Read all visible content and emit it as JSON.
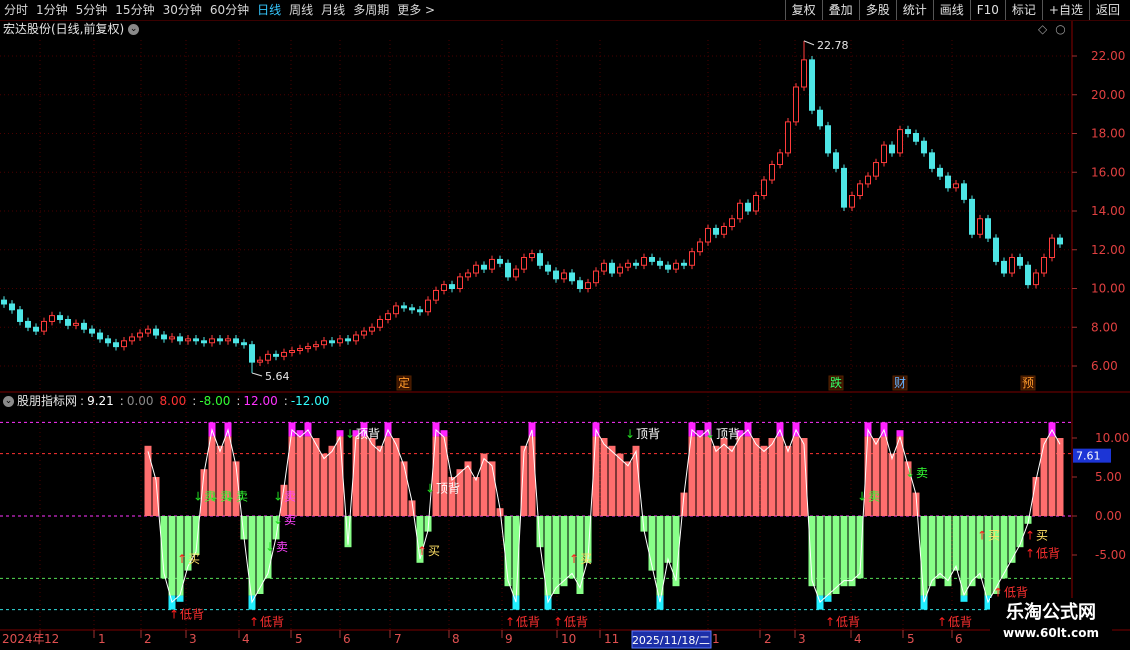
{
  "toolbar": {
    "left": [
      "分时",
      "1分钟",
      "5分钟",
      "15分钟",
      "30分钟",
      "60分钟",
      "日线",
      "周线",
      "月线",
      "多周期",
      "更多 >"
    ],
    "active_index": 6,
    "right": [
      "复权",
      "叠加",
      "多股",
      "统计",
      "画线",
      "F10",
      "标记",
      "+自选",
      "返回"
    ]
  },
  "title": {
    "stock": "宏达股份(日线,前复权)"
  },
  "icons": {
    "title_toggle": "chevron-circle-icon",
    "chart_settings": "diamond-icon",
    "chart_close": "circle-icon"
  },
  "colors": {
    "up": "#ff3b3b",
    "down": "#4ee6e6",
    "grid": "#4a0000",
    "axis_text": "#e04040",
    "cursor_bg": "#1c2fa8"
  },
  "price_axis": {
    "values": [
      22,
      20,
      18,
      16,
      14,
      12,
      10,
      8,
      6
    ],
    "labels": [
      "22.00",
      "20.00",
      "18.00",
      "16.00",
      "14.00",
      "12.00",
      "10.00",
      "8.00",
      "6.00"
    ]
  },
  "indicator_axis": {
    "values": [
      10,
      5,
      0,
      -5
    ],
    "labels": [
      "10.00",
      "5.00",
      "0.00",
      "-5.00"
    ],
    "current": 7.61,
    "current_label": "7.61"
  },
  "indicator_legend": {
    "name": "股朋指标网",
    "items": [
      {
        "prefix": ":",
        "text": "9.21",
        "color": "#ffffff"
      },
      {
        "prefix": ":",
        "text": "0.00",
        "color": "#8a8a8a"
      },
      {
        "prefix": "",
        "text": "8.00",
        "color": "#ff3333"
      },
      {
        "prefix": ":",
        "text": "-8.00",
        "color": "#33ff33"
      },
      {
        "prefix": ":",
        "text": "12.00",
        "color": "#ff33ff"
      },
      {
        "prefix": ":",
        "text": "-12.00",
        "color": "#33ffff"
      }
    ]
  },
  "time_axis": {
    "labels": [
      "2024年",
      "12",
      "1",
      "2",
      "3",
      "4",
      "5",
      "6",
      "7",
      "8",
      "9",
      "10",
      "11",
      "1",
      "2",
      "3",
      "4",
      "5",
      "6"
    ],
    "cursor": "2025/11/18/二"
  },
  "watermark": {
    "title": "乐淘公式网",
    "url": "www.60lt.com"
  },
  "chart_data": {
    "type": "candlestick",
    "price": {
      "first_open": 9.4,
      "close": [
        9.2,
        8.9,
        8.3,
        8.0,
        7.8,
        8.3,
        8.6,
        8.4,
        8.1,
        8.2,
        7.9,
        7.7,
        7.4,
        7.2,
        7.0,
        7.3,
        7.5,
        7.7,
        7.9,
        7.6,
        7.4,
        7.5,
        7.3,
        7.4,
        7.3,
        7.2,
        7.4,
        7.3,
        7.4,
        7.2,
        7.1,
        6.2,
        6.3,
        6.6,
        6.5,
        6.7,
        6.8,
        6.9,
        7.0,
        7.1,
        7.3,
        7.2,
        7.4,
        7.3,
        7.6,
        7.8,
        8.0,
        8.4,
        8.7,
        9.1,
        9.0,
        8.9,
        8.8,
        9.4,
        9.9,
        10.2,
        10.0,
        10.6,
        10.8,
        11.2,
        11.0,
        11.5,
        11.3,
        10.6,
        11.0,
        11.6,
        11.8,
        11.2,
        10.9,
        10.5,
        10.8,
        10.4,
        10.0,
        10.3,
        10.9,
        11.3,
        10.8,
        11.1,
        11.3,
        11.2,
        11.6,
        11.4,
        11.2,
        11.0,
        11.3,
        11.2,
        11.9,
        12.4,
        13.1,
        12.8,
        13.2,
        13.6,
        14.4,
        14.0,
        14.8,
        15.6,
        16.4,
        17.0,
        18.6,
        20.4,
        21.8,
        19.2,
        18.4,
        17.0,
        16.2,
        14.2,
        14.8,
        15.4,
        15.8,
        16.5,
        17.4,
        17.0,
        18.2,
        18.0,
        17.6,
        17.0,
        16.2,
        15.8,
        15.2,
        15.4,
        14.6,
        12.8,
        13.6,
        12.6,
        11.4,
        10.8,
        11.6,
        11.2,
        10.2,
        10.8,
        11.6,
        12.6,
        12.3
      ],
      "max": 22.78,
      "max_label": "22.78",
      "min": 5.64,
      "min_label": "5.64",
      "events": [
        {
          "label": "定",
          "i": 50,
          "color": "#ff9a2a"
        },
        {
          "label": "跌",
          "i": 104,
          "color": "#33ff66"
        },
        {
          "label": "财",
          "i": 112,
          "color": "#66b3ff"
        },
        {
          "label": "预",
          "i": 128,
          "color": "#ff9a2a"
        }
      ]
    },
    "indicator": {
      "levels": [
        {
          "value": 12,
          "color": "#ff33ff"
        },
        {
          "value": 8,
          "color": "#ff3333"
        },
        {
          "value": 0,
          "color": "#ff33ff"
        },
        {
          "value": -8,
          "color": "#55dd55"
        },
        {
          "value": -12,
          "color": "#33dddd"
        }
      ],
      "values": [
        0,
        0,
        0,
        0,
        0,
        0,
        0,
        0,
        0,
        0,
        0,
        0,
        0,
        0,
        0,
        0,
        0,
        0,
        9,
        5,
        -8,
        -12,
        -11,
        -7,
        -5,
        6,
        12,
        9,
        12,
        7,
        -3,
        -12,
        -10,
        -8,
        -3,
        4,
        12,
        11,
        12,
        10,
        8,
        9,
        11,
        -4,
        11,
        12,
        10,
        9,
        12,
        10,
        7,
        2,
        -6,
        -2,
        12,
        11,
        5,
        6,
        7,
        5,
        8,
        7,
        1,
        -9,
        -12,
        9,
        12,
        -4,
        -12,
        -10,
        -9,
        -8,
        -10,
        -6,
        12,
        10,
        9,
        8,
        7,
        9,
        -2,
        -7,
        -12,
        -6,
        -9,
        3,
        12,
        11,
        12,
        9,
        10,
        9,
        11,
        12,
        10,
        9,
        10,
        12,
        9,
        12,
        10,
        -9,
        -12,
        -11,
        -10,
        -9,
        -9,
        -8,
        12,
        10,
        12,
        8,
        11,
        7,
        3,
        -12,
        -9,
        -8,
        -9,
        -7,
        -11,
        -9,
        -8,
        -12,
        -10,
        -8,
        -6,
        -4,
        -1,
        5,
        10,
        12,
        10
      ],
      "bar_colors": {
        "positive": "#ff6e6e",
        "top": "#ff22ff",
        "negative": "#88ff88",
        "bottom": "#22eeff",
        "line": "#ffffff"
      },
      "signals": [
        {
          "text": "卖",
          "i": 25,
          "v": 2.5,
          "color": "#33ff33",
          "arrow": "down"
        },
        {
          "text": "卖",
          "i": 27,
          "v": 2.5,
          "color": "#33ff33",
          "arrow": "down"
        },
        {
          "text": "卖",
          "i": 29,
          "v": 2.5,
          "color": "#33ff33",
          "arrow": "down"
        },
        {
          "text": "买",
          "i": 23,
          "v": -5.5,
          "color": "#ffe066",
          "arrow": "up"
        },
        {
          "text": "低背",
          "i": 22,
          "v": -12.6,
          "color": "#ff3030",
          "arrow": "up"
        },
        {
          "text": "低背",
          "i": 32,
          "v": -13.6,
          "color": "#ff3030",
          "arrow": "up"
        },
        {
          "text": "卖",
          "i": 35,
          "v": 2.5,
          "color": "#ff44ff",
          "arrow": "down"
        },
        {
          "text": "卖",
          "i": 35,
          "v": -0.5,
          "color": "#ff44ff",
          "arrow": "down"
        },
        {
          "text": "卖",
          "i": 34,
          "v": -4,
          "color": "#ff44ff",
          "arrow": "down"
        },
        {
          "text": "顶背",
          "i": 44,
          "v": 10.5,
          "color": "#ffffff",
          "arrow": "down"
        },
        {
          "text": "顶背",
          "i": 54,
          "v": 3.5,
          "color": "#ffffff",
          "arrow": "down"
        },
        {
          "text": "买",
          "i": 53,
          "v": -4.5,
          "color": "#ffe066",
          "arrow": "up"
        },
        {
          "text": "低背",
          "i": 64,
          "v": -13.6,
          "color": "#ff3030",
          "arrow": "up"
        },
        {
          "text": "低背",
          "i": 70,
          "v": -13.6,
          "color": "#ff3030",
          "arrow": "up"
        },
        {
          "text": "买",
          "i": 72,
          "v": -5.5,
          "color": "#ffe066",
          "arrow": "up"
        },
        {
          "text": "顶背",
          "i": 79,
          "v": 10.5,
          "color": "#ffffff",
          "arrow": "down"
        },
        {
          "text": "顶背",
          "i": 89,
          "v": 10.5,
          "color": "#ffffff",
          "arrow": "down"
        },
        {
          "text": "卖",
          "i": 108,
          "v": 2.5,
          "color": "#33ff33",
          "arrow": "down"
        },
        {
          "text": "低背",
          "i": 104,
          "v": -13.6,
          "color": "#ff3030",
          "arrow": "up"
        },
        {
          "text": "卖",
          "i": 114,
          "v": 5.5,
          "color": "#33ff33",
          "arrow": "down"
        },
        {
          "text": "低背",
          "i": 118,
          "v": -13.6,
          "color": "#ff3030",
          "arrow": "up"
        },
        {
          "text": "买",
          "i": 123,
          "v": -2.5,
          "color": "#ffe066",
          "arrow": "up"
        },
        {
          "text": "低背",
          "i": 125,
          "v": -9.8,
          "color": "#ff3030",
          "arrow": "up"
        },
        {
          "text": "买",
          "i": 129,
          "v": -2.5,
          "color": "#ffe066",
          "arrow": "up"
        },
        {
          "text": "低背",
          "i": 129,
          "v": -4.8,
          "color": "#ff3030",
          "arrow": "up"
        }
      ]
    }
  }
}
